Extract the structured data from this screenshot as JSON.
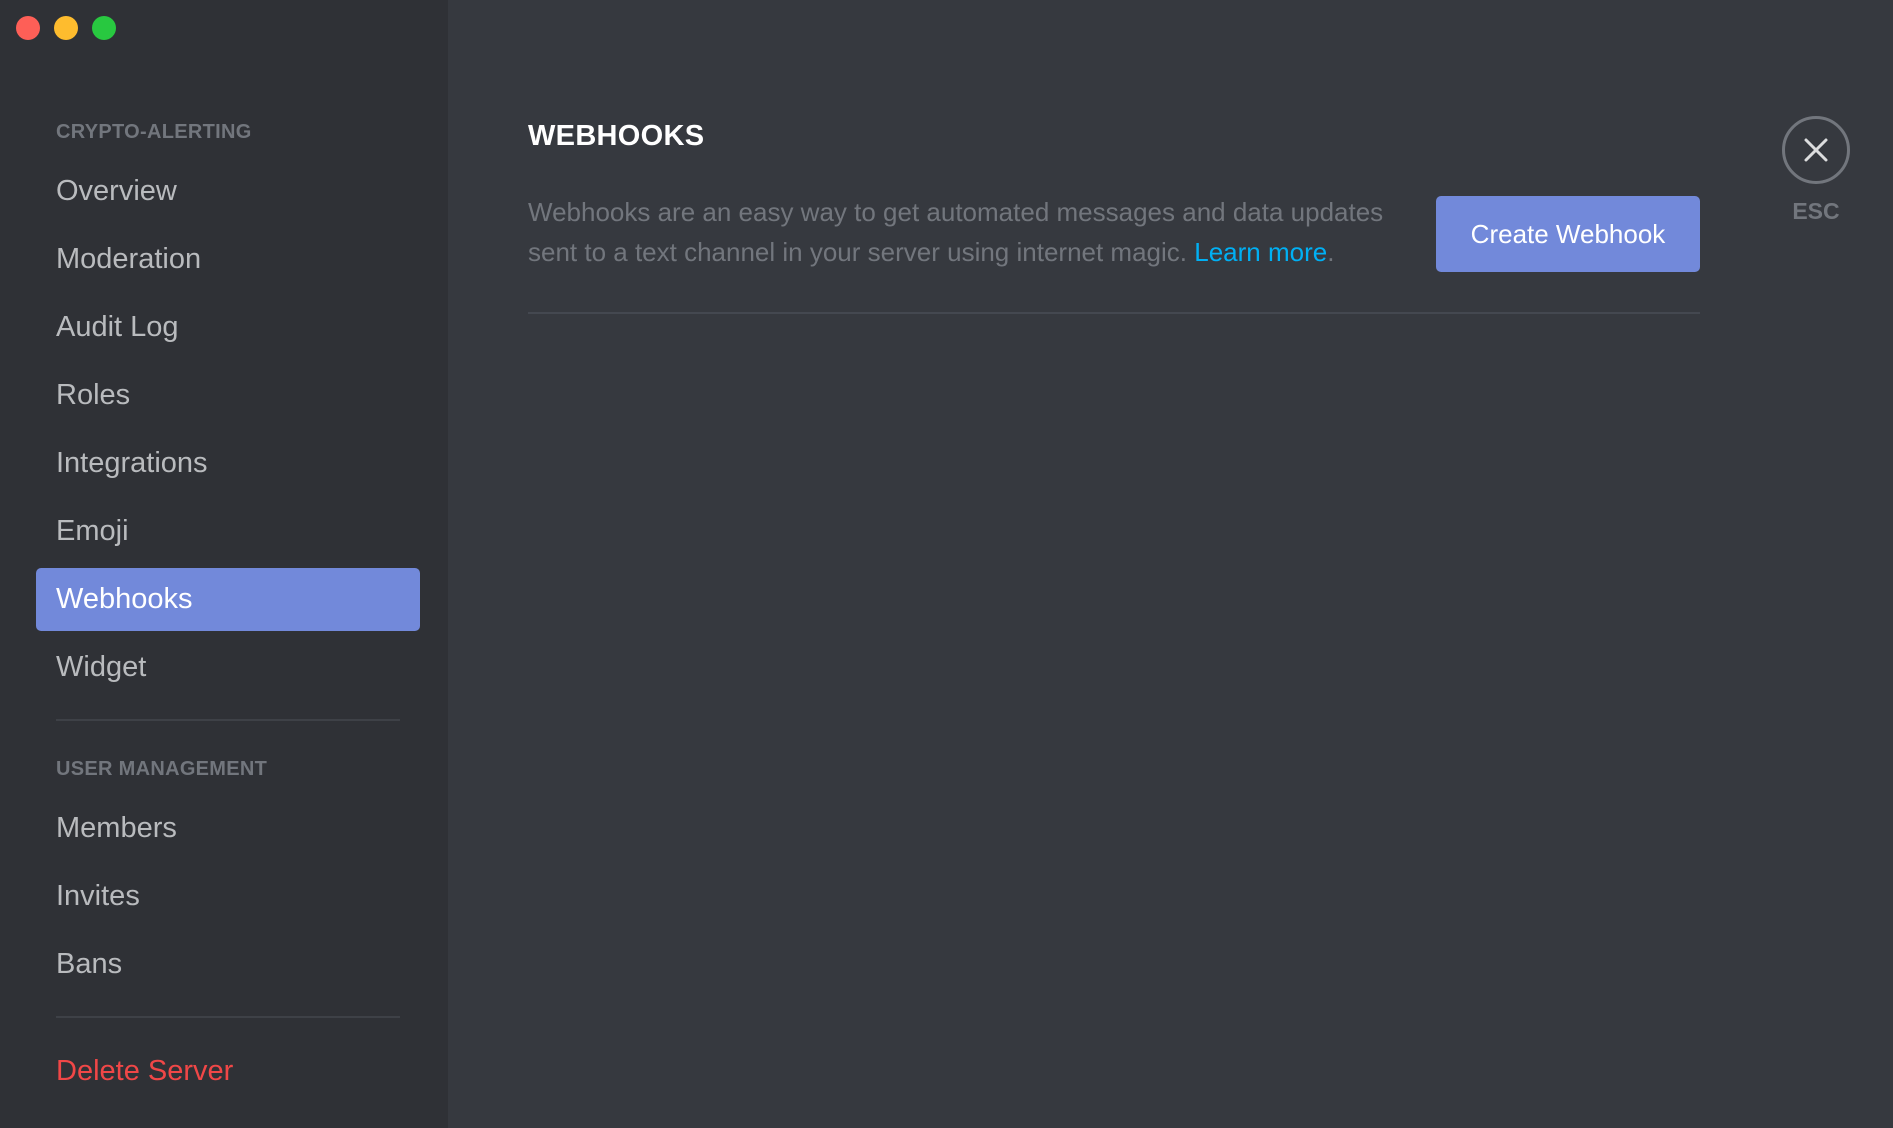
{
  "window": {
    "controls": [
      "close",
      "minimize",
      "maximize"
    ]
  },
  "sidebar": {
    "sections": [
      {
        "label": "CRYPTO-ALERTING",
        "items": [
          {
            "label": "Overview",
            "active": false
          },
          {
            "label": "Moderation",
            "active": false
          },
          {
            "label": "Audit Log",
            "active": false
          },
          {
            "label": "Roles",
            "active": false
          },
          {
            "label": "Integrations",
            "active": false
          },
          {
            "label": "Emoji",
            "active": false
          },
          {
            "label": "Webhooks",
            "active": true
          },
          {
            "label": "Widget",
            "active": false
          }
        ]
      },
      {
        "label": "USER MANAGEMENT",
        "items": [
          {
            "label": "Members",
            "active": false
          },
          {
            "label": "Invites",
            "active": false
          },
          {
            "label": "Bans",
            "active": false
          }
        ]
      }
    ],
    "danger_item": {
      "label": "Delete Server"
    }
  },
  "main": {
    "title": "WEBHOOKS",
    "description": "Webhooks are an easy way to get automated messages and data updates sent to a text channel in your server using internet magic. ",
    "learn_more": "Learn more",
    "description_end": ".",
    "create_button": "Create Webhook"
  },
  "close": {
    "icon": "close-icon",
    "label": "ESC"
  },
  "colors": {
    "accent": "#7289da",
    "link": "#00b0f4",
    "danger": "#f04747",
    "sidebar_bg": "#2f3136",
    "content_bg": "#36393f"
  }
}
